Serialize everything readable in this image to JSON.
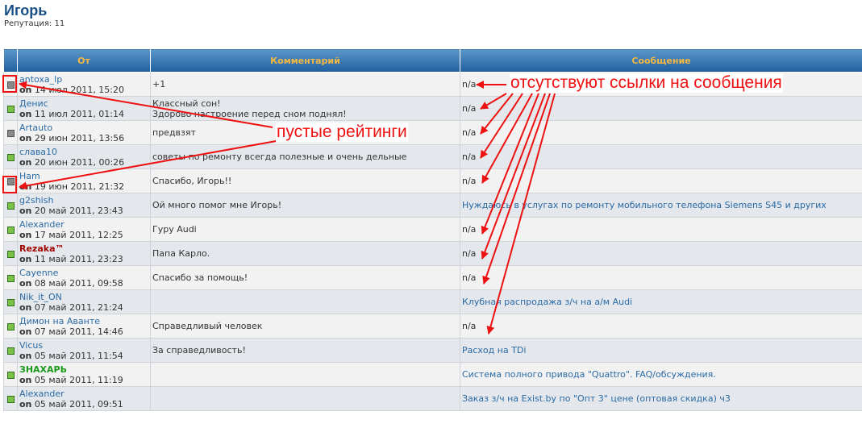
{
  "profile": {
    "name": "Игорь",
    "reputation": "Репутация: 11"
  },
  "table": {
    "headers": {
      "from": "От",
      "comment": "Комментарий",
      "message": "Сообщение"
    },
    "rows": [
      {
        "user": "antoxa_lp",
        "user_style": "normal",
        "indicator": "gray",
        "date": "14 июл 2011, 15:20",
        "comment_lines": [
          "+1"
        ],
        "message": "n/a",
        "message_is_link": false
      },
      {
        "user": "Денис",
        "user_style": "normal",
        "indicator": "green",
        "date": "11 июл 2011, 01:14",
        "comment_lines": [
          "Классный сон!",
          "Здорово настроение перед сном поднял!"
        ],
        "message": "n/a",
        "message_is_link": false
      },
      {
        "user": "Artauto",
        "user_style": "normal",
        "indicator": "gray",
        "date": "29 июн 2011, 13:56",
        "comment_lines": [
          "предвзят"
        ],
        "message": "n/a",
        "message_is_link": false
      },
      {
        "user": "слава10",
        "user_style": "normal",
        "indicator": "green",
        "date": "20 июн 2011, 00:26",
        "comment_lines": [
          "советы по ремонту всегда полезные и очень дельные"
        ],
        "message": "n/a",
        "message_is_link": false
      },
      {
        "user": "Ham",
        "user_style": "normal",
        "indicator": "gray",
        "date": "19 июн 2011, 21:32",
        "comment_lines": [
          "Спасибо, Игорь!!"
        ],
        "message": "n/a",
        "message_is_link": false
      },
      {
        "user": "g2shish",
        "user_style": "normal",
        "indicator": "green",
        "date": "20 май 2011, 23:43",
        "comment_lines": [
          "Ой много помог мне Игорь!"
        ],
        "message": "Нуждаюсь в услугах по ремонту мобильного телефона Siemens S45 и других",
        "message_is_link": true
      },
      {
        "user": "Alexander",
        "user_style": "normal",
        "indicator": "green",
        "date": "17 май 2011, 12:25",
        "comment_lines": [
          "Гуру Audi"
        ],
        "message": "n/a",
        "message_is_link": false
      },
      {
        "user": "Rezaka™",
        "user_style": "red",
        "indicator": "green",
        "date": "11 май 2011, 23:23",
        "comment_lines": [
          "Папа Карло."
        ],
        "message": "n/a",
        "message_is_link": false
      },
      {
        "user": "Cayenne",
        "user_style": "normal",
        "indicator": "green",
        "date": "08 май 2011, 09:58",
        "comment_lines": [
          "Спасибо за помощь!"
        ],
        "message": "n/a",
        "message_is_link": false
      },
      {
        "user": "Nik_it_ON",
        "user_style": "normal",
        "indicator": "green",
        "date": "07 май 2011, 21:24",
        "comment_lines": [
          ""
        ],
        "message": "Клубная распродажа з/ч на а/м Audi",
        "message_is_link": true
      },
      {
        "user": "Димон на Аванте",
        "user_style": "normal",
        "indicator": "green",
        "date": "07 май 2011, 14:46",
        "comment_lines": [
          "Справедливый человек"
        ],
        "message": "n/a",
        "message_is_link": false
      },
      {
        "user": "Vicus",
        "user_style": "normal",
        "indicator": "green",
        "date": "05 май 2011, 11:54",
        "comment_lines": [
          "За справедливость!"
        ],
        "message": "Расход на TDi",
        "message_is_link": true
      },
      {
        "user": "ЗНАХАРЬ",
        "user_style": "green",
        "indicator": "green",
        "date": "05 май 2011, 11:19",
        "comment_lines": [
          ""
        ],
        "message": "Система полного привода \"Quattro\". FAQ/обсуждения.",
        "message_is_link": true
      },
      {
        "user": "Alexander",
        "user_style": "normal",
        "indicator": "green",
        "date": "05 май 2011, 09:51",
        "comment_lines": [
          ""
        ],
        "message": "Заказ з/ч на Exist.by по \"Опт 3\" цене (оптовая скидка) ч3",
        "message_is_link": true
      }
    ],
    "on_label": "on"
  },
  "annotations": {
    "missing_links": "отсутствуют ссылки на сообщения",
    "empty_ratings": "пустые рейтинги",
    "color": "#ee1111"
  }
}
